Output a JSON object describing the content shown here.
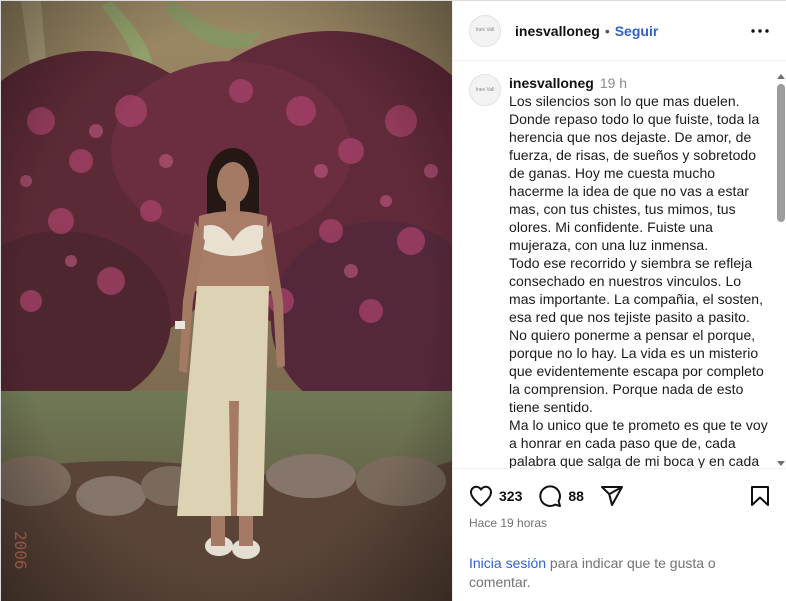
{
  "post": {
    "username": "inesvalloneg",
    "follow_label": "Seguir",
    "dot": "•",
    "avatar_text": "Ines Vall",
    "photo_date_stamp": "2006",
    "caption": {
      "username": "inesvalloneg",
      "time": "19 h",
      "text": "Los silencios son lo que mas duelen.\nDonde repaso todo lo que fuiste, toda la herencia que nos dejaste. De amor, de fuerza, de risas, de sueños y sobretodo de ganas. Hoy me cuesta mucho hacerme la idea de que no vas a estar mas, con tus chistes, tus mimos, tus olores. Mi confidente. Fuiste una mujeraza, con una luz inmensa.\nTodo ese recorrido y siembra se refleja consechado en nuestros vinculos. Lo mas importante. La compañia, el sosten, esa red que nos tejiste pasito a pasito.\nNo quiero ponerme a pensar el porque, porque no lo hay. La vida es un misterio que evidentemente escapa por completo la comprension. Porque nada de esto tiene sentido.\nMa lo unico que te prometo es que te voy a honrar en cada paso que de, cada palabra que salga de mi boca y en cada"
    },
    "likes": "323",
    "comments": "88",
    "time_ago": "Hace 19 horas",
    "login": {
      "link": "Inicia sesión",
      "rest": " para indicar que te gusta o comentar."
    }
  },
  "icons": {
    "more": "more-options-icon",
    "like": "heart-icon",
    "comment": "comment-icon",
    "share": "share-icon",
    "save": "bookmark-icon"
  },
  "colors": {
    "link": "#2f62c9",
    "muted": "#737373",
    "border": "#dbdbdb"
  }
}
